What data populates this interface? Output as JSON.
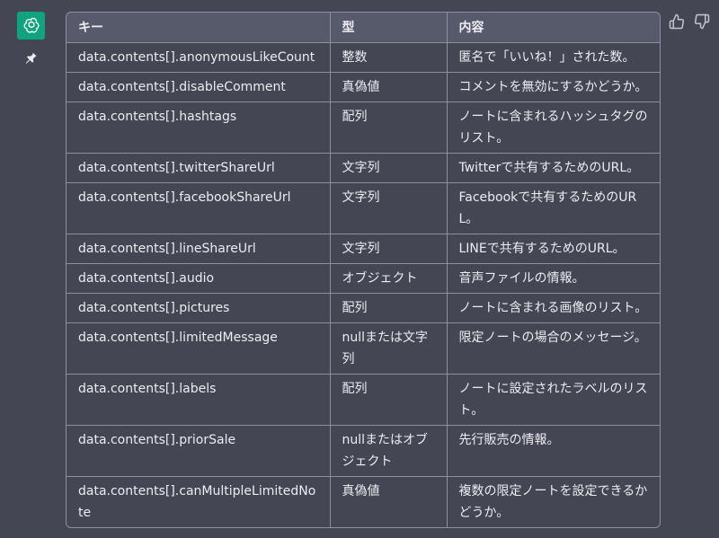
{
  "table": {
    "headers": [
      "キー",
      "型",
      "内容"
    ],
    "rows": [
      [
        "data.contents[].anonymousLikeCount",
        "整数",
        "匿名で「いいね！」された数。"
      ],
      [
        "data.contents[].disableComment",
        "真偽値",
        "コメントを無効にするかどうか。"
      ],
      [
        "data.contents[].hashtags",
        "配列",
        "ノートに含まれるハッシュタグのリスト。"
      ],
      [
        "data.contents[].twitterShareUrl",
        "文字列",
        "Twitterで共有するためのURL。"
      ],
      [
        "data.contents[].facebookShareUrl",
        "文字列",
        "Facebookで共有するためのURL。"
      ],
      [
        "data.contents[].lineShareUrl",
        "文字列",
        "LINEで共有するためのURL。"
      ],
      [
        "data.contents[].audio",
        "オブジェクト",
        "音声ファイルの情報。"
      ],
      [
        "data.contents[].pictures",
        "配列",
        "ノートに含まれる画像のリスト。"
      ],
      [
        "data.contents[].limitedMessage",
        "nullまたは文字列",
        "限定ノートの場合のメッセージ。"
      ],
      [
        "data.contents[].labels",
        "配列",
        "ノートに設定されたラベルのリスト。"
      ],
      [
        "data.contents[].priorSale",
        "nullまたはオブジェクト",
        "先行販売の情報。"
      ],
      [
        "data.contents[].canMultipleLimitedNote",
        "真偽値",
        "複数の限定ノートを設定できるかどうか。"
      ]
    ]
  },
  "icons": {
    "avatar": "openai-logo-icon",
    "pin": "pin-icon",
    "like": "thumbs-up-icon",
    "dislike": "thumbs-down-icon"
  },
  "colors": {
    "background": "#444654",
    "avatar": "#10a37f",
    "header_bg": "#575a6b",
    "border": "#8e8ea0",
    "text": "#ececf1"
  }
}
